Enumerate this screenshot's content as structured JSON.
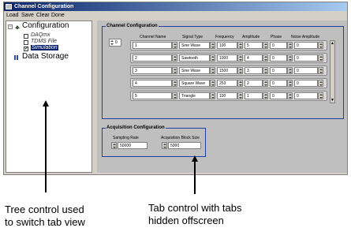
{
  "window": {
    "title": "Channel Configuration"
  },
  "menu": [
    "Load",
    "Save",
    "Clear",
    "Done"
  ],
  "tree": {
    "root": "Configuration",
    "children": [
      {
        "label": "DAQmx",
        "checked": false
      },
      {
        "label": "TDMS File",
        "checked": false
      },
      {
        "label": "Simulation",
        "checked": true,
        "selected": true
      }
    ],
    "second_root": "Data Storage"
  },
  "channel_config": {
    "group_title": "Channel Configuration",
    "index_value": "0",
    "headers": [
      "Channel Name",
      "Signal Type",
      "Frequency",
      "Amplitude",
      "Phase",
      "Noise Amplitude"
    ],
    "rows": [
      {
        "name": "1",
        "signal": "Sine Wave",
        "frequency": "100",
        "amplitude": "5",
        "phase": "0",
        "noise": "0"
      },
      {
        "name": "2",
        "signal": "Sawtooth",
        "frequency": "1000",
        "amplitude": "4",
        "phase": "0",
        "noise": "0"
      },
      {
        "name": "3",
        "signal": "Sine Wave",
        "frequency": "1500",
        "amplitude": "3",
        "phase": "0",
        "noise": "0"
      },
      {
        "name": "4",
        "signal": "Square Wave",
        "frequency": "253",
        "amplitude": "2",
        "phase": "0",
        "noise": "0"
      },
      {
        "name": "5",
        "signal": "Triangle",
        "frequency": "100",
        "amplitude": "1",
        "phase": "0",
        "noise": "0"
      }
    ]
  },
  "acquisition_config": {
    "group_title": "Acquisition Configuration",
    "sampling_rate_label": "Sampling Rate",
    "sampling_rate_value": "50000",
    "block_size_label": "Acquisition Block Size",
    "block_size_value": "5000"
  },
  "annotations": {
    "tree_caption_line1": "Tree control used",
    "tree_caption_line2": "to switch tab view",
    "tab_caption_line1": "Tab control with tabs",
    "tab_caption_line2": "hidden offscreen"
  },
  "colors": {
    "title_bar": "#0a246a",
    "group_border": "#1f3fa6",
    "panel_bg": "#bfbfbf",
    "window_bg": "#d4d0c8",
    "selection": "#0a246a"
  }
}
